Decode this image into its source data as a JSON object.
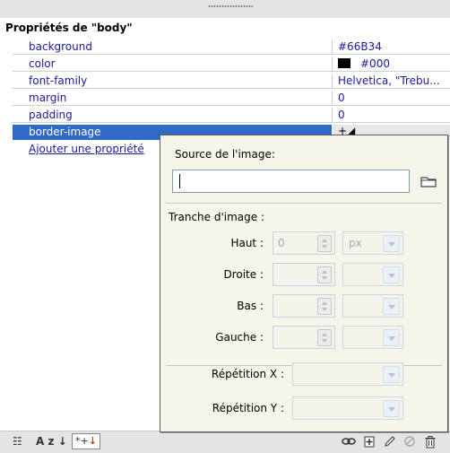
{
  "panel": {
    "title": "Propriétés de \"body\"",
    "properties": [
      {
        "name": "background",
        "value": "#66B34"
      },
      {
        "name": "color",
        "value": "#000",
        "swatch": "#000000"
      },
      {
        "name": "font-family",
        "value": "Helvetica, \"Trebu..."
      },
      {
        "name": "margin",
        "value": "0"
      },
      {
        "name": "padding",
        "value": "0"
      },
      {
        "name": "border-image",
        "value": "",
        "selected": true
      }
    ],
    "add_property_label": "Ajouter une propriété"
  },
  "popup": {
    "source_label": "Source de l'image:",
    "source_value": "",
    "slice_label": "Tranche d'image :",
    "slices": [
      {
        "label": "Haut :",
        "value": "0",
        "unit": "px"
      },
      {
        "label": "Droite :",
        "value": "",
        "unit": ""
      },
      {
        "label": "Bas :",
        "value": "",
        "unit": ""
      },
      {
        "label": "Gauche :",
        "value": "",
        "unit": ""
      }
    ],
    "repeat_x_label": "Répétition X :",
    "repeat_y_label": "Répétition Y :",
    "repeat_x_value": "",
    "repeat_y_value": ""
  },
  "toolbar": {
    "list_view_icon": "☷",
    "az_sort_icon": "A z ↓",
    "set_props_prefix": "*+",
    "set_props_arrow": "↓"
  },
  "colors": {
    "selection": "#316ac5",
    "link": "#1a1a99",
    "popup_bg": "#f6f5ea"
  }
}
